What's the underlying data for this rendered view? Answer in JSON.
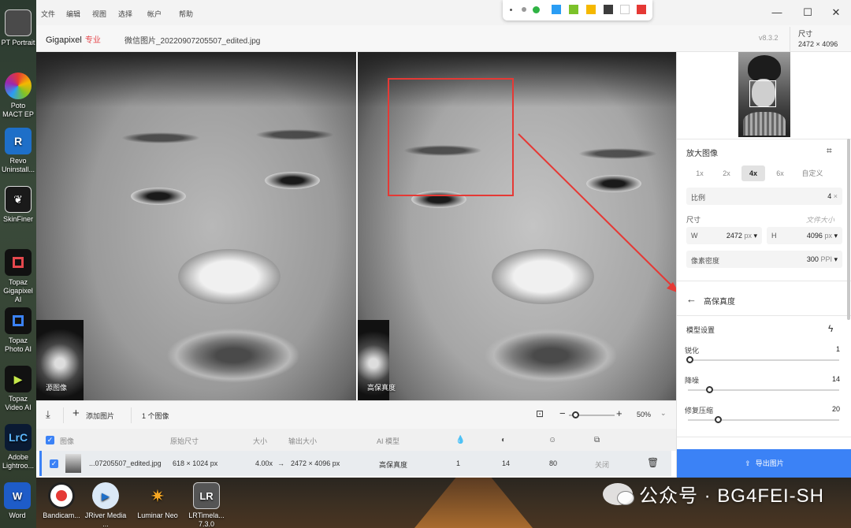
{
  "desktop": {
    "icons": [
      {
        "label": "PT Portrait"
      },
      {
        "label": "Poto MACT EP"
      },
      {
        "label": "Revo Uninstall..."
      },
      {
        "label": "SkinFiner"
      },
      {
        "label": "Topaz Gigapixel AI"
      },
      {
        "label": "Topaz Photo AI"
      },
      {
        "label": "Topaz Video AI"
      },
      {
        "label": "Adobe Lightroo..."
      }
    ],
    "taskbar_icons": [
      {
        "label": "Word"
      },
      {
        "label": "Bandicam..."
      },
      {
        "label": "JRiver Media ..."
      },
      {
        "label": "Luminar Neo"
      },
      {
        "label": "LRTimela... 7.3.0"
      }
    ],
    "watermark": "公众号 · BG4FEI-SH"
  },
  "menubar": {
    "items": [
      "文件",
      "编辑",
      "视图",
      "选择",
      "帐户",
      "帮助"
    ],
    "swatches": [
      "#2a9df4",
      "#7cc22a",
      "#f5b800",
      "#3c3c3c",
      "#ffffff",
      "#e53935"
    ]
  },
  "titlebar": {
    "brand": "Gigapixel",
    "brand_tag": "专业",
    "filename": "微信图片_20220907205507_edited.jpg",
    "version": "v8.3.2",
    "size_label": "尺寸",
    "size_value": "2472 × 4096"
  },
  "panes": {
    "left_label": "源图像",
    "right_label": "高保真度"
  },
  "toolbar": {
    "add_label": "添加图片",
    "count_label": "1 个图像",
    "zoom": "50%"
  },
  "table": {
    "headers": [
      "图像",
      "原始尺寸",
      "大小",
      "输出大小",
      "AI 模型"
    ],
    "row": {
      "name": "...07205507_edited.jpg",
      "original_size": "618 × 1024 px",
      "scale": "4.00x",
      "output_size": "2472 × 4096 px",
      "model": "高保真度",
      "sharpen": "1",
      "denoise": "14",
      "face": "80",
      "status": "关闭"
    }
  },
  "panel": {
    "upscale_title": "放大图像",
    "scale_options": [
      "1x",
      "2x",
      "4x",
      "6x",
      "自定义"
    ],
    "selected_scale": "4x",
    "ratio_label": "比例",
    "ratio_value": "4",
    "ratio_unit": "×",
    "dims_label": "尺寸",
    "file_size_link": "文件大小",
    "width_label": "W",
    "width_value": "2472",
    "width_unit": "px",
    "height_label": "H",
    "height_value": "4096",
    "height_unit": "px",
    "density_label": "像素密度",
    "density_value": "300",
    "density_unit": "PPI",
    "model_name": "高保真度",
    "model_settings": "模型设置",
    "sliders": [
      {
        "label": "锐化",
        "value": "1",
        "fraction": 0.01
      },
      {
        "label": "降噪",
        "value": "14",
        "fraction": 0.14
      },
      {
        "label": "修复压缩",
        "value": "20",
        "fraction": 0.2
      }
    ],
    "export_label": "导出图片"
  }
}
